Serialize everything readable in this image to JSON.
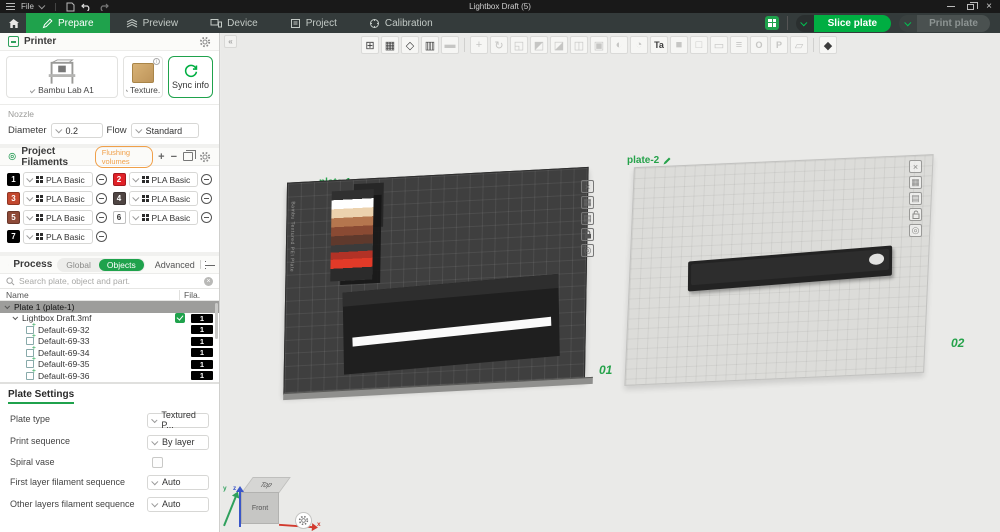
{
  "window": {
    "title": "Lightbox Draft (5)"
  },
  "menubar": {
    "file_label": "File"
  },
  "tabs": [
    {
      "label": "Prepare"
    },
    {
      "label": "Preview"
    },
    {
      "label": "Device"
    },
    {
      "label": "Project"
    },
    {
      "label": "Calibration"
    }
  ],
  "topbar": {
    "slice_label": "Slice plate",
    "print_label": "Print plate"
  },
  "printer": {
    "header": "Printer",
    "model": "Bambu Lab A1",
    "plate": "Texture...",
    "info": "i",
    "sync_label": "Sync info"
  },
  "nozzle": {
    "header": "Nozzle",
    "diameter_label": "Diameter",
    "diameter_value": "0.2",
    "flow_label": "Flow",
    "flow_value": "Standard"
  },
  "filaments": {
    "header": "Project Filaments",
    "flushing_label": "Flushing volumes",
    "add": "+",
    "remove": "−",
    "slots": [
      {
        "id": "1",
        "color": "#000000",
        "text_color": "#ffffff",
        "label": "PLA Basic"
      },
      {
        "id": "2",
        "color": "#e02128",
        "text_color": "#ffffff",
        "label": "PLA Basic"
      },
      {
        "id": "3",
        "color": "#c2472e",
        "text_color": "#ffffff",
        "label": "PLA Basic"
      },
      {
        "id": "4",
        "color": "#4f4543",
        "text_color": "#ffffff",
        "label": "PLA Basic"
      },
      {
        "id": "5",
        "color": "#8e4a38",
        "text_color": "#ffffff",
        "label": "PLA Basic"
      },
      {
        "id": "6",
        "color": "#ffffff",
        "text_color": "#333333",
        "label": "PLA Basic"
      },
      {
        "id": "7",
        "color": "#000000",
        "text_color": "#ffffff",
        "label": "PLA Basic"
      }
    ]
  },
  "process": {
    "header": "Process",
    "toggle_global": "Global",
    "toggle_objects": "Objects",
    "advanced_label": "Advanced",
    "search_placeholder": "Search plate, object and part.",
    "col_name": "Name",
    "col_fila": "Fila.",
    "tree": [
      {
        "name": "Plate 1 (plate-1)",
        "badge": ""
      },
      {
        "name": "Lightbox Draft.3mf",
        "badge": "1"
      },
      {
        "name": "Default-69-32",
        "badge": "1"
      },
      {
        "name": "Default-69-33",
        "badge": "1"
      },
      {
        "name": "Default-69-34",
        "badge": "1"
      },
      {
        "name": "Default-69-35",
        "badge": "1"
      },
      {
        "name": "Default-69-36",
        "badge": "1"
      }
    ]
  },
  "plate_settings": {
    "title": "Plate Settings",
    "rows": [
      {
        "label": "Plate type",
        "value": "Textured P..."
      },
      {
        "label": "Print sequence",
        "value": "By layer"
      },
      {
        "label": "Spiral vase",
        "value": ""
      },
      {
        "label": "First layer filament sequence",
        "value": "Auto"
      },
      {
        "label": "Other layers filament sequence",
        "value": "Auto"
      }
    ]
  },
  "toolbar": {
    "icons": [
      {
        "name": "add-object",
        "glyph": "⊞",
        "color": "#3c3c3c"
      },
      {
        "name": "add-plate",
        "glyph": "▦",
        "color": "#3c3c3c"
      },
      {
        "name": "auto-orient",
        "glyph": "◇",
        "color": "#3c3c3c"
      },
      {
        "name": "arrange",
        "glyph": "▥",
        "color": "#3c3c3c"
      },
      {
        "name": "merge",
        "glyph": "▬",
        "color": "#c6c6c4"
      },
      {
        "name": "move",
        "glyph": "+",
        "color": "#c6c6c4"
      },
      {
        "name": "rotate",
        "glyph": "↻",
        "color": "#c6c6c4"
      },
      {
        "name": "scale",
        "glyph": "◱",
        "color": "#c6c6c4"
      },
      {
        "name": "place-on-face",
        "glyph": "◩",
        "color": "#c6c6c4"
      },
      {
        "name": "cut",
        "glyph": "◪",
        "color": "#c6c6c4"
      },
      {
        "name": "split-objects",
        "glyph": "◫",
        "color": "#c6c6c4"
      },
      {
        "name": "split-parts",
        "glyph": "▣",
        "color": "#c6c6c4"
      },
      {
        "name": "color-paint",
        "glyph": "◐",
        "color": "#c6c6c4"
      },
      {
        "name": "support-paint",
        "glyph": "◔",
        "color": "#c6c6c4"
      },
      {
        "name": "text-tool",
        "glyph": "Ta",
        "color": "#3c3c3c"
      },
      {
        "name": "seam-paint",
        "glyph": "■",
        "color": "#c6c6c4"
      },
      {
        "name": "mesh-boolean",
        "glyph": "□",
        "color": "#c6c6c4"
      },
      {
        "name": "measure",
        "glyph": "▭",
        "color": "#c6c6c4"
      },
      {
        "name": "variable-layer-height",
        "glyph": "≡",
        "color": "#c6c6c4"
      },
      {
        "name": "clone",
        "glyph": "O",
        "color": "#c6c6c4"
      },
      {
        "name": "primitive",
        "glyph": "P",
        "color": "#c6c6c4"
      },
      {
        "name": "eraser",
        "glyph": "▱",
        "color": "#c6c6c4"
      },
      {
        "name": "assembly-view",
        "glyph": "◆",
        "color": "#3c3c3c"
      }
    ]
  },
  "viewport": {
    "plate1": {
      "label": "plate-1",
      "number": "01",
      "bed_text": "Bambu Textured PEI Plate"
    },
    "plate2": {
      "label": "plate-2",
      "number": "02"
    },
    "plate_icons": {
      "close": "×",
      "arrange": "▦",
      "settings": "▤",
      "marker": "◎"
    },
    "cube": {
      "top": "Top",
      "front": "Front"
    },
    "axes": {
      "x": "x",
      "y": "y",
      "z": "z"
    }
  },
  "colors": {
    "accent": "#00ae42",
    "flushing_outline": "#f0a04a",
    "plate_label": "#25a24a"
  }
}
